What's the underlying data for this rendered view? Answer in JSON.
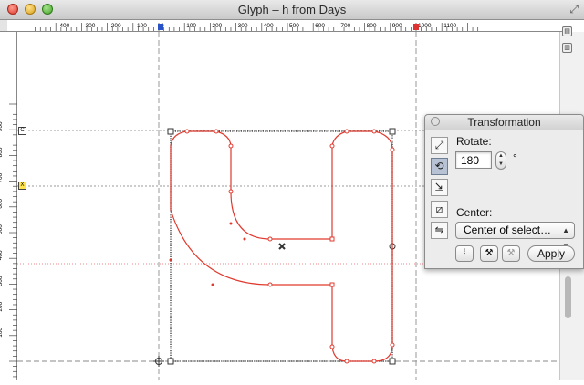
{
  "window": {
    "title": "Glyph – h from Days"
  },
  "ruler": {
    "h_labels": [
      "-400",
      "-300",
      "-200",
      "-100",
      "0",
      "100",
      "200",
      "300",
      "400",
      "500",
      "600",
      "700",
      "800",
      "900",
      "1000",
      "1100"
    ],
    "v_labels": [
      "900",
      "800",
      "700",
      "600",
      "500",
      "400",
      "300",
      "200",
      "100"
    ]
  },
  "markers": {
    "c_label": "C",
    "x_label": "X"
  },
  "panel": {
    "title": "Transformation",
    "rotate_label": "Rotate:",
    "rotate_value": "180",
    "degree_symbol": "°",
    "center_label": "Center:",
    "center_value": "Center of select…",
    "apply_label": "Apply"
  },
  "colors": {
    "accent_curve": "#e03a2f",
    "guide": "#9a9a9a",
    "panel_bg": "#ececec"
  }
}
